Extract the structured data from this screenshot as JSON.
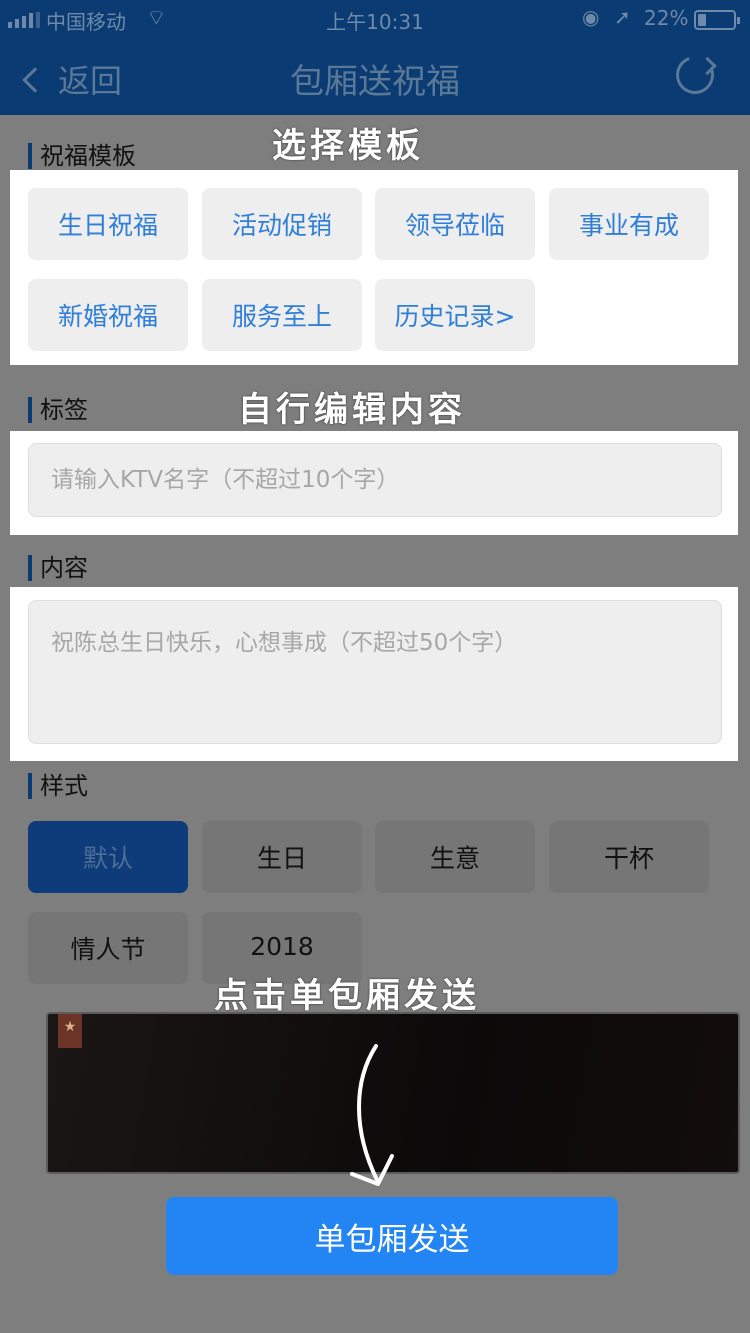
{
  "status_bar": {
    "carrier": "中国移动",
    "time": "上午10:31",
    "battery_percent": "22%"
  },
  "nav": {
    "back_label": "返回",
    "title": "包厢送祝福"
  },
  "annotations": {
    "select_template": "选择模板",
    "edit_content": "自行编辑内容",
    "click_send": "点击单包厢发送"
  },
  "sections": {
    "template": {
      "label": "祝福模板",
      "items": [
        "生日祝福",
        "活动促销",
        "领导莅临",
        "事业有成",
        "新婚祝福",
        "服务至上",
        "历史记录>"
      ]
    },
    "tag": {
      "label": "标签",
      "placeholder": "请输入KTV名字（不超过10个字）"
    },
    "content": {
      "label": "内容",
      "placeholder": "祝陈总生日快乐，心想事成（不超过50个字）"
    },
    "style": {
      "label": "样式",
      "items": [
        "默认",
        "生日",
        "生意",
        "干杯",
        "情人节",
        "2018"
      ],
      "selected": "默认"
    }
  },
  "send_button": "单包厢发送",
  "colors": {
    "nav_bg": "#0a3c73",
    "accent": "#2385f3",
    "chip_text": "#2f7ed8"
  }
}
